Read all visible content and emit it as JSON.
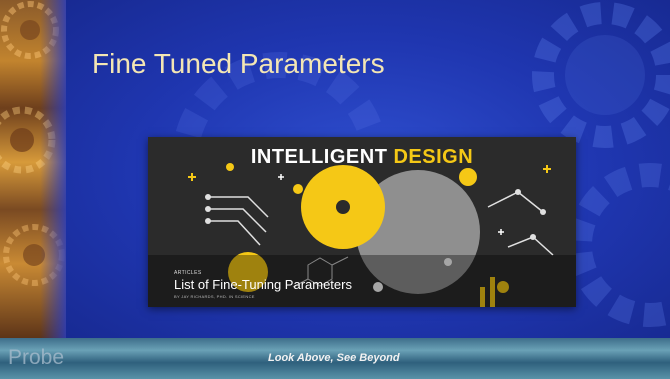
{
  "slide": {
    "title": "Fine Tuned Parameters"
  },
  "article_image": {
    "heading_first": "INTELLIGENT",
    "heading_second": "DESIGN",
    "category": "ARTICLES",
    "title": "List of Fine-Tuning Parameters",
    "byline": "BY JAY RICHARDS, PHD. IN SCIENCE",
    "accent_color": "#f5c816"
  },
  "footer": {
    "logo": "Probe",
    "tagline": "Look Above, See Beyond"
  }
}
